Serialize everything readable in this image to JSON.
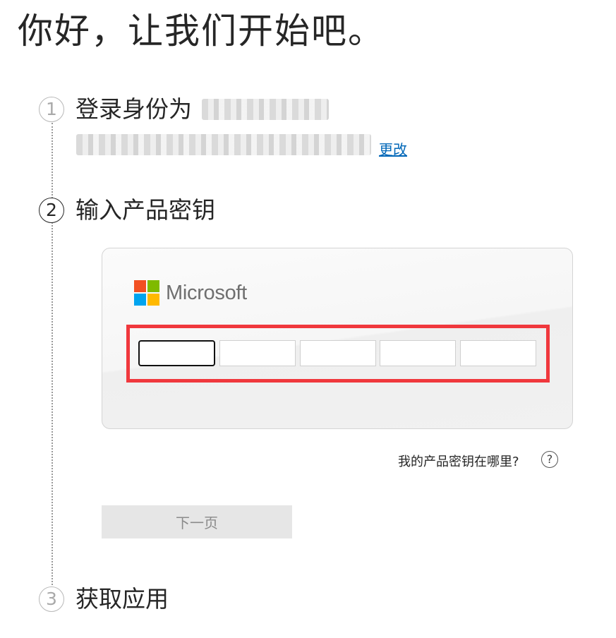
{
  "page": {
    "heading": "你好，让我们开始吧。"
  },
  "steps": [
    {
      "number": "1",
      "title": "登录身份为",
      "state": "done"
    },
    {
      "number": "2",
      "title": "输入产品密钥",
      "state": "active"
    },
    {
      "number": "3",
      "title": "获取应用",
      "state": "pending"
    }
  ],
  "account": {
    "change_link": "更改"
  },
  "key_card": {
    "brand": "Microsoft",
    "logo_colors": [
      "#f25022",
      "#7fba00",
      "#00a4ef",
      "#ffb900"
    ],
    "key_inputs": [
      "",
      "",
      "",
      "",
      ""
    ],
    "highlight_color": "#f0383d"
  },
  "help": {
    "text": "我的产品密钥在哪里?",
    "icon_glyph": "?",
    "icon": "help-circle-icon"
  },
  "actions": {
    "next_label": "下一页",
    "next_enabled": false
  },
  "colors": {
    "link": "#0067b8",
    "text": "#262626",
    "disabled_button_bg": "#e6e6e6"
  }
}
